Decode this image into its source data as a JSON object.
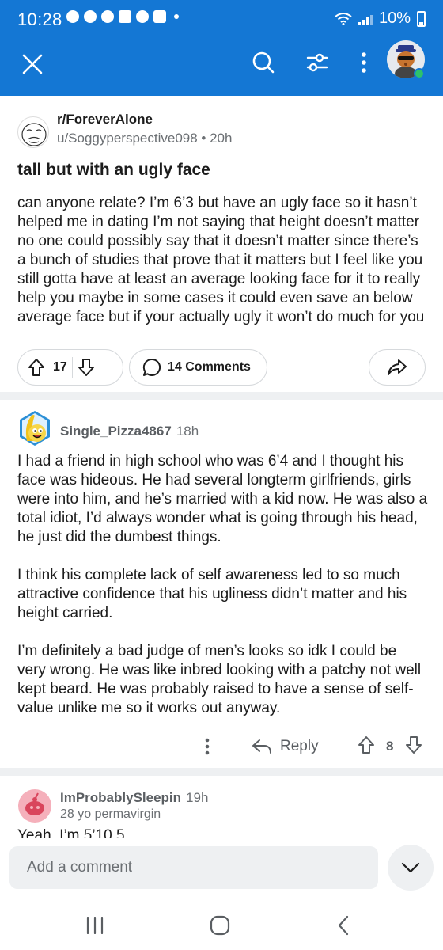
{
  "status_bar": {
    "time": "10:28",
    "battery": "10%"
  },
  "header": {
    "close_icon": "close-icon",
    "search_icon": "search-icon",
    "filter_icon": "filter-icon",
    "more_icon": "more-vertical-icon",
    "accent_color": "#1477d4"
  },
  "post": {
    "subreddit": "r/ForeverAlone",
    "meta": "u/Soggyperspective098 • 20h",
    "title": "tall but with an ugly face",
    "body": "can anyone relate? I’m 6’3 but have an ugly face so it hasn’t helped me in dating I’m not saying that height doesn’t matter no one could possibly say that it doesn’t matter since there’s a bunch of studies that prove that it matters but I feel like you still gotta have at least an average looking face for it to really help you maybe in some cases it could even save an below average face but if your actually ugly it won’t do much for you",
    "votes": "17",
    "comments_label": "14 Comments"
  },
  "comments": [
    {
      "username": "Single_Pizza4867",
      "age": "18h",
      "paragraphs": [
        "I had a friend in high school who was 6’4 and I thought his face was hideous. He had several longterm girlfriends, girls were into him, and he’s married with a kid now. He was also a total idiot, I’d always wonder what is going through his head, he just did the dumbest things.",
        "I think his complete lack of self awareness led to so much attractive confidence that his ugliness didn’t matter and his height carried.",
        "I’m definitely a bad judge of men’s looks so idk I could be very wrong. He was like inbred looking with a patchy not well kept beard. He was probably raised to have a sense of self-value unlike me so it works out anyway."
      ],
      "reply_label": "Reply",
      "score": "8"
    },
    {
      "username": "ImProbablySleepin",
      "age": "19h",
      "flair": "28 yo permavirgin",
      "body": "Yeah, I’m 5’10.5"
    }
  ],
  "composer": {
    "placeholder": "Add a comment"
  }
}
